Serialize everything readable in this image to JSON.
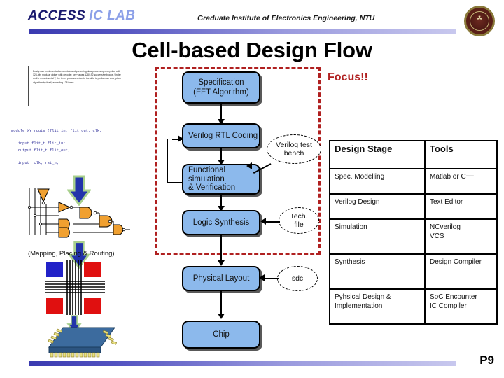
{
  "header": {
    "lab_name_part1": "ACCESS",
    "lab_name_part2": "IC LAB",
    "institute": "Graduate Institute of Electronics Engineering, NTU",
    "seal_name": "ntu-seal",
    "rule_color": "#4a4ab8"
  },
  "title": "Cell-based Design Flow",
  "left_column": {
    "spec_textbox_text": "Design are implemented a complete and preceding data processing encryption with 128-bits modular cipher with decoder, key values 128/192 successive blocks. Under on the experimental T, the times processed due to the able to perform an encryption algorithm by itself, according 128 times ...",
    "code_lines": [
      "module XY_route (flit_in, flit_out, clk,",
      "",
      "   input flit_t flit_in;",
      "   output flit_t flit_out;",
      "",
      "   input  clk, rst_n;"
    ],
    "gate_schematic_name": "gate-level-schematic",
    "mapping_caption": "(Mapping, Placing & Routing)",
    "place_route_name": "placement-routing-figure",
    "chip_package_name": "chip-package-figure"
  },
  "focus": {
    "label": "Focus!!",
    "color": "#b02020"
  },
  "flow": {
    "boxes": [
      {
        "id": "specification",
        "line1": "Specification",
        "line2": "(FFT Algorithm)"
      },
      {
        "id": "rtl-coding",
        "line1": "Verilog RTL Coding",
        "line2": ""
      },
      {
        "id": "functional-sim",
        "line1": "Functional",
        "line2": "simulation",
        "line3": "& Verification"
      },
      {
        "id": "logic-synthesis",
        "line1": "Logic Synthesis",
        "line2": ""
      },
      {
        "id": "physical-layout",
        "line1": "Physical Layout",
        "line2": ""
      },
      {
        "id": "chip",
        "line1": "Chip",
        "line2": ""
      }
    ],
    "notes": [
      {
        "id": "verilog-testbench",
        "line1": "Verilog test",
        "line2": "bench"
      },
      {
        "id": "tech-file",
        "line1": "Tech.",
        "line2": "file"
      },
      {
        "id": "sdc",
        "line1": "sdc",
        "line2": ""
      }
    ],
    "box_fill": "#8cb9ec"
  },
  "table": {
    "headers": [
      "Design Stage",
      "Tools"
    ],
    "rows": [
      {
        "stage": [
          "Spec. Modelling"
        ],
        "tools": [
          "Matlab or C++"
        ]
      },
      {
        "stage": [
          "Verilog Design"
        ],
        "tools": [
          "Text Editor"
        ]
      },
      {
        "stage": [
          "Simulation"
        ],
        "tools": [
          "NCverilog",
          "VCS"
        ]
      },
      {
        "stage": [
          "Synthesis"
        ],
        "tools": [
          "Design Compiler"
        ]
      },
      {
        "stage": [
          "Pyhsical Design &",
          "Implementation"
        ],
        "tools": [
          "SoC Encounter",
          "IC Compiler"
        ]
      }
    ]
  },
  "footer": {
    "page_number": "P9"
  }
}
